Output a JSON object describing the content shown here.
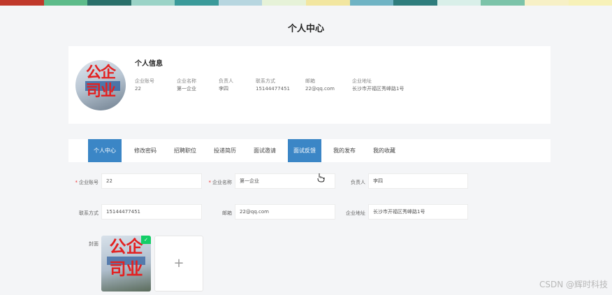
{
  "banner_colors": [
    "#c0392b",
    "#5dbb8a",
    "#2a6f6a",
    "#9bd3c7",
    "#3a9a9a",
    "#b7d6e0",
    "#e6f2d8",
    "#f2e6a0",
    "#6fb3c4",
    "#2f7d7d",
    "#d9efe9",
    "#7cc3a9",
    "#f7f0c6",
    "#f7f1b8"
  ],
  "page_title": "个人中心",
  "profile": {
    "section_title": "个人信息",
    "fields": [
      {
        "label": "企业账号",
        "value": "22"
      },
      {
        "label": "企业名称",
        "value": "第一企业"
      },
      {
        "label": "负责人",
        "value": "李四"
      },
      {
        "label": "联系方式",
        "value": "15144477451"
      },
      {
        "label": "邮箱",
        "value": "22@qq.com"
      },
      {
        "label": "企业地址",
        "value": "长沙市开福区秀峰路1号"
      }
    ],
    "avatar_text_line1": "公企",
    "avatar_text_line2": "司业"
  },
  "tabs": [
    {
      "label": "个人中心"
    },
    {
      "label": "修改密码"
    },
    {
      "label": "招聘职位"
    },
    {
      "label": "投递简历"
    },
    {
      "label": "面试邀请"
    },
    {
      "label": "面试反馈"
    },
    {
      "label": "我的发布"
    },
    {
      "label": "我的收藏"
    }
  ],
  "form": {
    "account": {
      "label": "企业账号",
      "value": "22",
      "required": "*"
    },
    "name": {
      "label": "企业名称",
      "value": "第一企业",
      "required": "*"
    },
    "manager": {
      "label": "负责人",
      "value": "李四"
    },
    "phone": {
      "label": "联系方式",
      "value": "15144477451"
    },
    "email": {
      "label": "邮箱",
      "value": "22@qq.com"
    },
    "address": {
      "label": "企业地址",
      "value": "长沙市开福区秀峰路1号"
    },
    "cover_label": "封面",
    "cover_text_line1": "公企",
    "cover_text_line2": "司业",
    "check_mark": "✓",
    "upload_plus": "+"
  },
  "watermark": "CSDN @辉时科技"
}
